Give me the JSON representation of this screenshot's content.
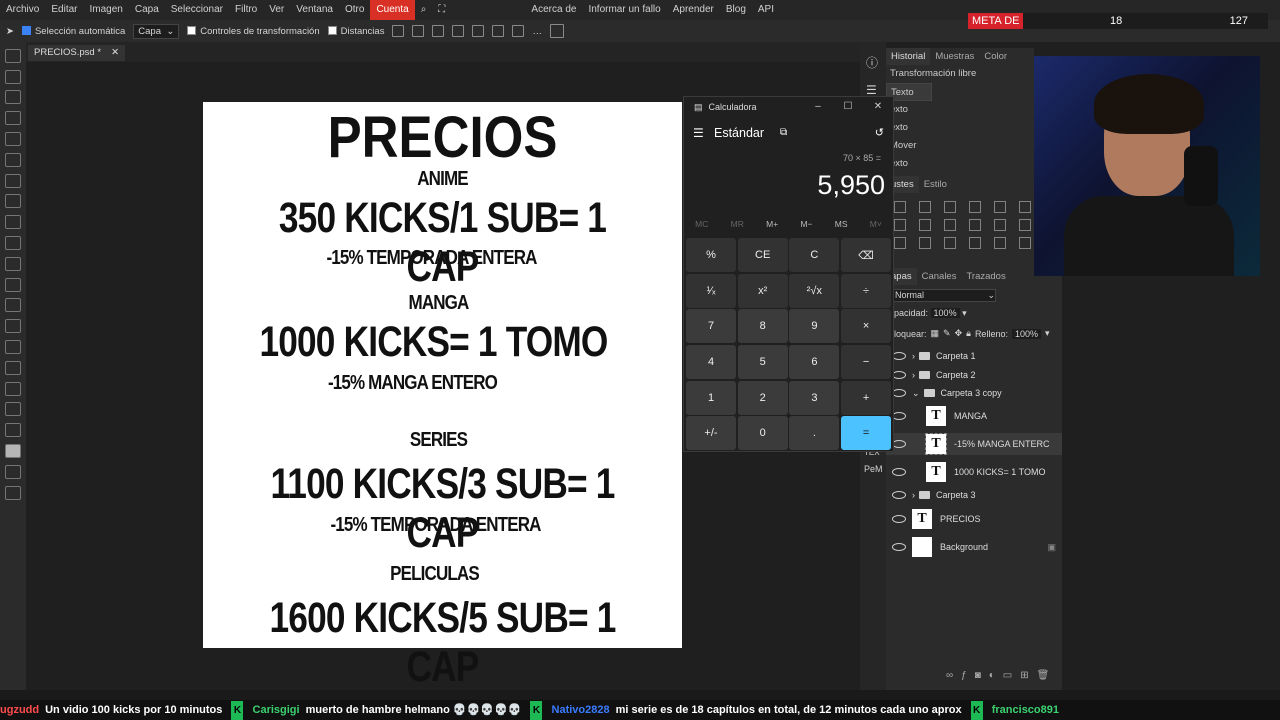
{
  "menubar": {
    "items": [
      "Archivo",
      "Editar",
      "Imagen",
      "Capa",
      "Seleccionar",
      "Filtro",
      "Ver",
      "Ventana",
      "Otro",
      "Cuenta"
    ],
    "right": [
      "Acerca de",
      "Informar un fallo",
      "Aprender",
      "Blog",
      "API"
    ]
  },
  "options": {
    "auto_select": "Selección automática",
    "layer_select": "Capa",
    "transform_controls": "Controles de transformación",
    "distances": "Distancias"
  },
  "document": {
    "tab": "PRECIOS.psd *"
  },
  "canvas": {
    "title": "PRECIOS",
    "anime_heading": "ANIME",
    "anime_price": "350 KICKS/1 SUB= 1 CAP",
    "anime_discount": "-15% TEMPORADA ENTERA",
    "manga_heading": "MANGA",
    "manga_price": "1000 KICKS= 1 TOMO",
    "manga_discount": "-15% MANGA ENTERO",
    "series_heading": "SERIES",
    "series_price": "1100 KICKS/3 SUB= 1 CAP",
    "series_discount": "-15% TEMPORADA ENTERA",
    "peliculas_heading": "PELICULAS",
    "peliculas_price": "1600 KICKS/5 SUB= 1 CAP"
  },
  "calculator": {
    "title": "Calculadora",
    "mode": "Estándar",
    "expression": "70 × 85 =",
    "result": "5,950",
    "memory": [
      "MC",
      "MR",
      "M+",
      "M−",
      "MS",
      "M˅"
    ],
    "keys": [
      "%",
      "CE",
      "C",
      "⌫",
      "¹⁄ₓ",
      "x²",
      "²√x",
      "÷",
      "7",
      "8",
      "9",
      "×",
      "4",
      "5",
      "6",
      "−",
      "1",
      "2",
      "3",
      "+",
      "+/-",
      "0",
      ".",
      "="
    ]
  },
  "history": {
    "tabs": [
      "Historial",
      "Muestras",
      "Color"
    ],
    "items": [
      "Transformación libre",
      "Texto",
      "exto",
      "exto",
      "Mover",
      "exto"
    ]
  },
  "adjustments": {
    "tabs": [
      "ustes",
      "Estilo"
    ]
  },
  "layers": {
    "tabs": [
      "apas",
      "Canales",
      "Trazados"
    ],
    "blend": "Normal",
    "opacity_label": "pacidad:",
    "opacity": "100%",
    "lock_label": "loquear:",
    "fill_label": "Relleno:",
    "fill": "100%",
    "items": [
      {
        "name": "Carpeta 1",
        "kind": "folder"
      },
      {
        "name": "Carpeta 2",
        "kind": "folder"
      },
      {
        "name": "Carpeta 3 copy",
        "kind": "folder-open"
      },
      {
        "name": "MANGA",
        "kind": "text"
      },
      {
        "name": "-15% MANGA ENTERC",
        "kind": "text"
      },
      {
        "name": "1000 KICKS= 1 TOMO",
        "kind": "text"
      },
      {
        "name": "Carpeta 3",
        "kind": "folder"
      },
      {
        "name": "PRECIOS",
        "kind": "text"
      },
      {
        "name": "Background",
        "kind": "image"
      }
    ]
  },
  "side_labels": [
    "TEX",
    "PeM"
  ],
  "subgoal": {
    "label": "META DE SUBS",
    "current": "18",
    "target": "127"
  },
  "chat": [
    {
      "user": "ugzudd",
      "color": "red",
      "text": "Un vidio 100 kicks por 10 minutos"
    },
    {
      "user": "Carisgigi",
      "color": "green",
      "text": "muerto de hambre helmano 💀💀💀💀💀"
    },
    {
      "user": "Nativo2828",
      "color": "blue",
      "text": "mi serie es de 18 capítulos en total, de 12 minutos cada uno aprox"
    },
    {
      "user": "francisco891",
      "color": "green",
      "text": ""
    }
  ]
}
